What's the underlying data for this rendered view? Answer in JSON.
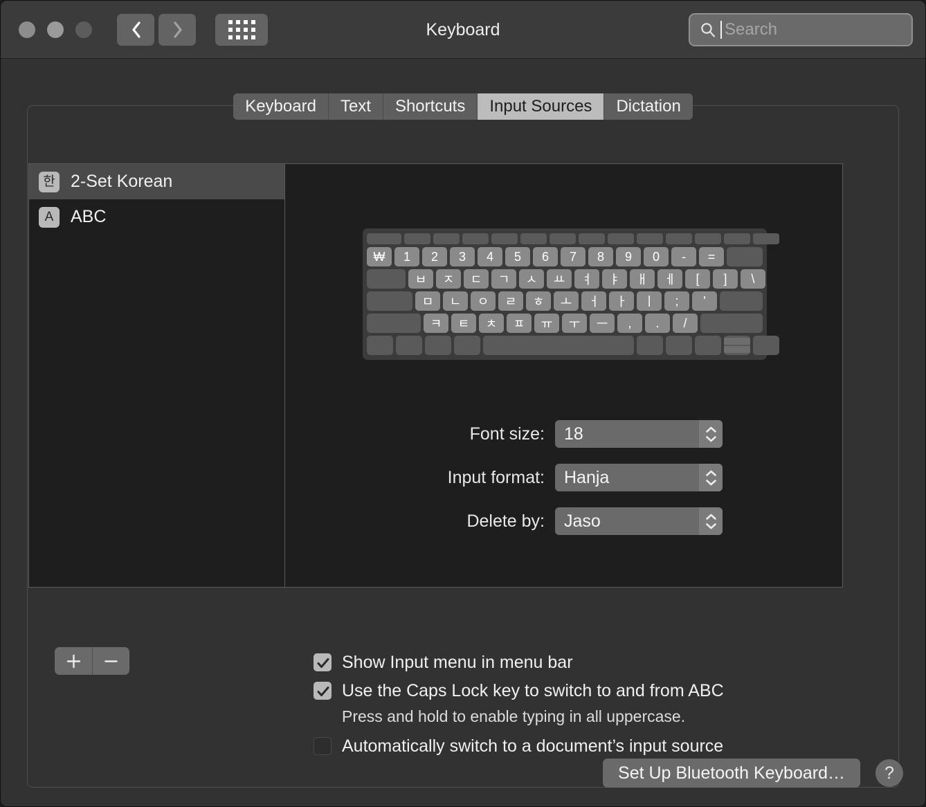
{
  "window": {
    "title": "Keyboard",
    "traffic_lights": [
      "close",
      "minimize",
      "zoom"
    ],
    "nav": {
      "back_icon": "chevron-left-icon",
      "forward_icon": "chevron-right-icon",
      "grid_icon": "grid-view-icon"
    },
    "search": {
      "placeholder": "Search",
      "value": "",
      "icon": "search-icon"
    }
  },
  "tabs": [
    {
      "label": "Keyboard",
      "selected": false
    },
    {
      "label": "Text",
      "selected": false
    },
    {
      "label": "Shortcuts",
      "selected": false
    },
    {
      "label": "Input Sources",
      "selected": true
    },
    {
      "label": "Dictation",
      "selected": false
    }
  ],
  "input_sources": [
    {
      "icon_glyph": "한",
      "label": "2-Set Korean",
      "selected": true
    },
    {
      "icon_glyph": "A",
      "label": "ABC",
      "selected": false
    }
  ],
  "keyboard_preview": {
    "rows": [
      {
        "type": "function",
        "keys": [
          "",
          "",
          "",
          "",
          "",
          "",
          "",
          "",
          "",
          "",
          "",
          "",
          "",
          ""
        ]
      },
      {
        "type": "main",
        "keys": [
          "₩",
          "1",
          "2",
          "3",
          "4",
          "5",
          "6",
          "7",
          "8",
          "9",
          "0",
          "-",
          "="
        ],
        "trailing_blank": 1
      },
      {
        "type": "main",
        "leading_blank": 1,
        "keys": [
          "ㅂ",
          "ㅈ",
          "ㄷ",
          "ㄱ",
          "ㅅ",
          "ㅛ",
          "ㅕ",
          "ㅑ",
          "ㅐ",
          "ㅔ",
          "[",
          "]",
          "\\"
        ]
      },
      {
        "type": "main",
        "leading_blank": 1,
        "keys": [
          "ㅁ",
          "ㄴ",
          "ㅇ",
          "ㄹ",
          "ㅎ",
          "ㅗ",
          "ㅓ",
          "ㅏ",
          "ㅣ",
          ";",
          "'"
        ],
        "trailing_blank": 1
      },
      {
        "type": "main",
        "leading_blank": 1,
        "keys": [
          "ㅋ",
          "ㅌ",
          "ㅊ",
          "ㅍ",
          "ㅠ",
          "ㅜ",
          "ㅡ",
          ",",
          ".",
          "/"
        ],
        "trailing_blank": 1
      },
      {
        "type": "modifier",
        "keys": [
          "",
          "",
          "",
          "",
          "space",
          "",
          "",
          "",
          "arrows",
          ""
        ]
      }
    ]
  },
  "settings": {
    "font_size": {
      "label": "Font size:",
      "value": "18"
    },
    "input_format": {
      "label": "Input format:",
      "value": "Hanja"
    },
    "delete_by": {
      "label": "Delete by:",
      "value": "Jaso"
    }
  },
  "list_actions": {
    "add": "+",
    "remove": "−"
  },
  "checkboxes": [
    {
      "label": "Show Input menu in menu bar",
      "checked": true,
      "hint": ""
    },
    {
      "label": "Use the Caps Lock key to switch to and from ABC",
      "checked": true,
      "hint": "Press and hold to enable typing in all uppercase."
    },
    {
      "label": "Automatically switch to a document’s input source",
      "checked": false,
      "hint": ""
    }
  ],
  "footer": {
    "bluetooth_button": "Set Up Bluetooth Keyboard…",
    "help_button": "?"
  },
  "colors": {
    "window_bg": "#323232",
    "titlebar_bg": "#3b3b3b",
    "list_bg": "#1e1e1e",
    "selected_tab_bg": "#bcbcbc",
    "control_bg": "#6a6a6a",
    "text": "#f0f0f0"
  }
}
